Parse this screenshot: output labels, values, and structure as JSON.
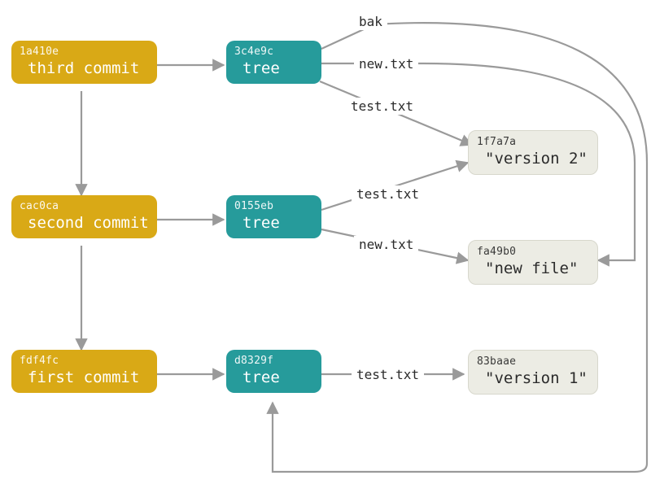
{
  "colors": {
    "commit": "#d9a916",
    "tree": "#269b9b",
    "blob_bg": "#ecece4",
    "arrow": "#9a9a9a"
  },
  "commits": [
    {
      "sha": "1a410e",
      "title": "third commit"
    },
    {
      "sha": "cac0ca",
      "title": "second commit"
    },
    {
      "sha": "fdf4fc",
      "title": "first commit"
    }
  ],
  "trees": [
    {
      "sha": "3c4e9c",
      "title": "tree"
    },
    {
      "sha": "0155eb",
      "title": "tree"
    },
    {
      "sha": "d8329f",
      "title": "tree"
    }
  ],
  "blobs": [
    {
      "sha": "1f7a7a",
      "title": "\"version 2\""
    },
    {
      "sha": "fa49b0",
      "title": "\"new file\""
    },
    {
      "sha": "83baae",
      "title": "\"version 1\""
    }
  ],
  "edge_labels": {
    "bak": "bak",
    "new_txt": "new.txt",
    "test_txt": "test.txt"
  }
}
